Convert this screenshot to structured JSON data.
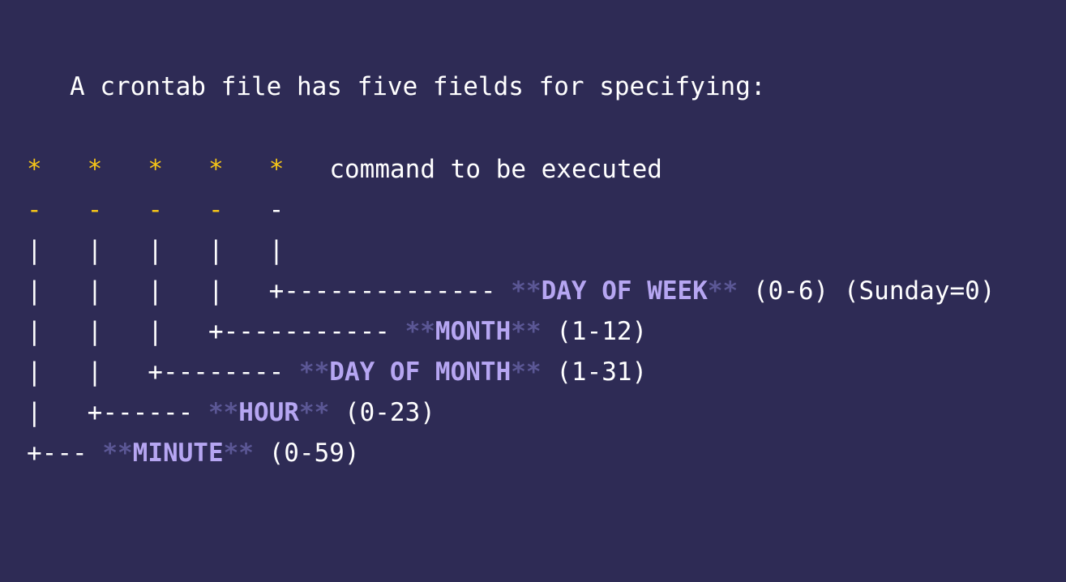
{
  "intro": "A crontab file has five fields for specifying:",
  "colors": {
    "background": "#2e2b55",
    "star": "#f5c518",
    "field": "#b6a6f2",
    "markdown": "#5b5795",
    "text": "#ffffff"
  },
  "lines": [
    [
      {
        "t": "*",
        "c": "star"
      },
      {
        "t": "   ",
        "c": "plain"
      },
      {
        "t": "*",
        "c": "star"
      },
      {
        "t": "   ",
        "c": "plain"
      },
      {
        "t": "*",
        "c": "star"
      },
      {
        "t": "   ",
        "c": "plain"
      },
      {
        "t": "*",
        "c": "star"
      },
      {
        "t": "   ",
        "c": "plain"
      },
      {
        "t": "*",
        "c": "star"
      },
      {
        "t": "   command to be executed",
        "c": "plain"
      }
    ],
    [
      {
        "t": "-",
        "c": "dash-y"
      },
      {
        "t": "   ",
        "c": "plain"
      },
      {
        "t": "-",
        "c": "dash-y"
      },
      {
        "t": "   ",
        "c": "plain"
      },
      {
        "t": "-",
        "c": "dash-y"
      },
      {
        "t": "   ",
        "c": "plain"
      },
      {
        "t": "-",
        "c": "dash-y"
      },
      {
        "t": "   -",
        "c": "plain"
      }
    ],
    [
      {
        "t": "|   |   |   |   |",
        "c": "plain"
      }
    ],
    [
      {
        "t": "|   |   |   |   +-------------- ",
        "c": "plain"
      },
      {
        "t": "**",
        "c": "mark"
      },
      {
        "t": "DAY OF WEEK",
        "c": "field"
      },
      {
        "t": "**",
        "c": "mark"
      },
      {
        "t": " (0-6) (Sunday=0)",
        "c": "plain"
      }
    ],
    [
      {
        "t": "|   |   |   +----------- ",
        "c": "plain"
      },
      {
        "t": "**",
        "c": "mark"
      },
      {
        "t": "MONTH",
        "c": "field"
      },
      {
        "t": "**",
        "c": "mark"
      },
      {
        "t": " (1-12)",
        "c": "plain"
      }
    ],
    [
      {
        "t": "|   |   +-------- ",
        "c": "plain"
      },
      {
        "t": "**",
        "c": "mark"
      },
      {
        "t": "DAY OF MONTH",
        "c": "field"
      },
      {
        "t": "**",
        "c": "mark"
      },
      {
        "t": " (1-31)",
        "c": "plain"
      }
    ],
    [
      {
        "t": "|   +------ ",
        "c": "plain"
      },
      {
        "t": "**",
        "c": "mark"
      },
      {
        "t": "HOUR",
        "c": "field"
      },
      {
        "t": "**",
        "c": "mark"
      },
      {
        "t": " (0-23)",
        "c": "plain"
      }
    ],
    [
      {
        "t": "+--- ",
        "c": "plain"
      },
      {
        "t": "**",
        "c": "mark"
      },
      {
        "t": "MINUTE",
        "c": "field"
      },
      {
        "t": "**",
        "c": "mark"
      },
      {
        "t": " (0-59)",
        "c": "plain"
      }
    ]
  ]
}
